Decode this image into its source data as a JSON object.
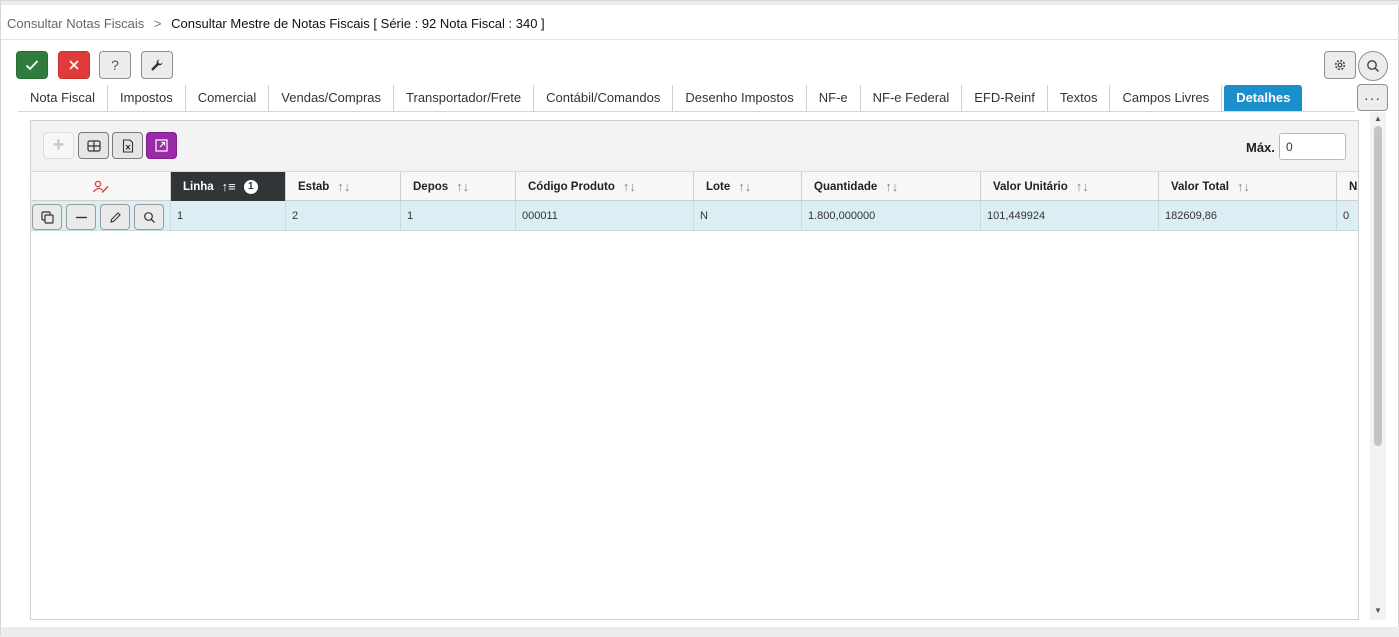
{
  "breadcrumb": {
    "parent": "Consultar Notas Fiscais",
    "separator": ">",
    "current": "Consultar Mestre de Notas Fiscais [ Série : 92 Nota Fiscal : 340 ]"
  },
  "toolbar": {
    "help_label": "?",
    "more_label": "···"
  },
  "tabs": [
    {
      "label": "Nota Fiscal"
    },
    {
      "label": "Impostos"
    },
    {
      "label": "Comercial"
    },
    {
      "label": "Vendas/Compras"
    },
    {
      "label": "Transportador/Frete"
    },
    {
      "label": "Contábil/Comandos"
    },
    {
      "label": "Desenho Impostos"
    },
    {
      "label": "NF-e"
    },
    {
      "label": "NF-e Federal"
    },
    {
      "label": "EFD-Reinf"
    },
    {
      "label": "Textos"
    },
    {
      "label": "Campos Livres"
    },
    {
      "label": "Detalhes"
    }
  ],
  "active_tab_index": 12,
  "grid": {
    "add_label": "+",
    "max_label": "Máx.",
    "max_value": "0",
    "sort_order_badge": "1",
    "columns": [
      {
        "label": "Linha"
      },
      {
        "label": "Estab"
      },
      {
        "label": "Depos"
      },
      {
        "label": "Código Produto"
      },
      {
        "label": "Lote"
      },
      {
        "label": "Quantidade"
      },
      {
        "label": "Valor Unitário"
      },
      {
        "label": "Valor Total"
      },
      {
        "label": "N"
      }
    ],
    "rows": [
      {
        "cells": [
          "1",
          "2",
          "1",
          "000011",
          "N",
          "1.800,000000",
          "101,449924",
          "182609,86",
          "0"
        ]
      }
    ]
  },
  "colors": {
    "ok": "#2f7d3e",
    "cancel": "#e03b3b",
    "active_tab": "#1a8fcc",
    "expand_button": "#9a2aa8",
    "sorted_header": "#323538",
    "row_highlight": "#dbeef3",
    "filter_icon": "#d83b3b"
  },
  "icons": {
    "ok": "check-icon",
    "cancel": "close-icon",
    "tool": "wrench-icon",
    "gear": "gear-icon",
    "search": "search-icon",
    "add": "plus-icon",
    "grid": "grid-icon",
    "excel": "excel-icon",
    "expand": "expand-icon",
    "filter": "clear-filter-icon",
    "copy": "copy-icon",
    "remove": "minus-icon",
    "edit": "pencil-icon",
    "row_search": "search-icon"
  }
}
